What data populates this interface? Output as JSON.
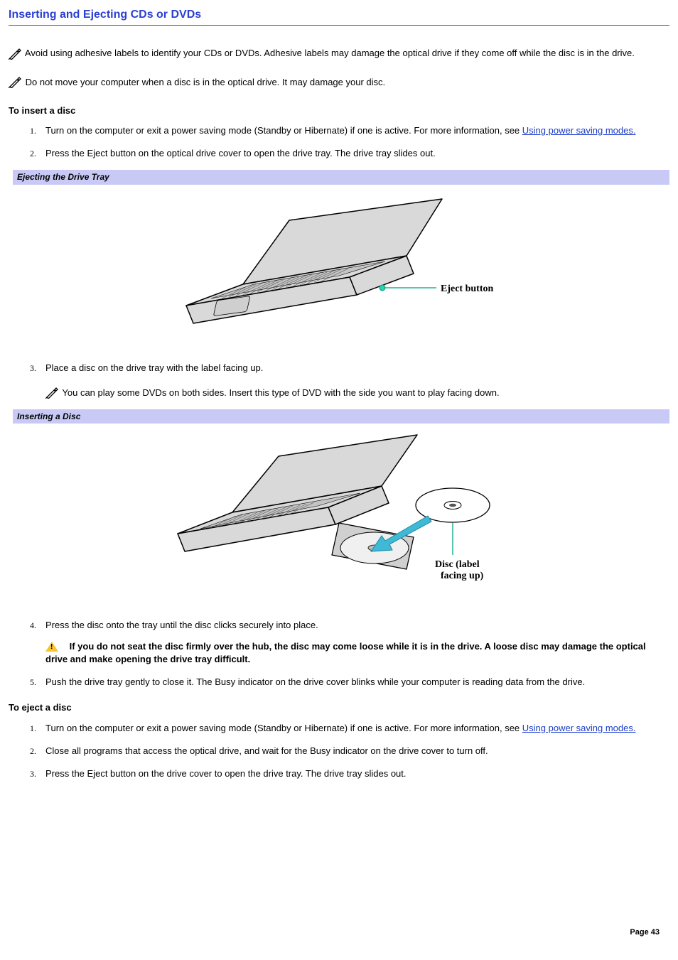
{
  "title": "Inserting and Ejecting CDs or DVDs",
  "notes": {
    "adhesive": "Avoid using adhesive labels to identify your CDs or DVDs. Adhesive labels may damage the optical drive if they come off while the disc is in the drive.",
    "moving": "Do not move your computer when a disc is in the optical drive. It may damage your disc.",
    "dvd_sides": "You can play some DVDs on both sides. Insert this type of DVD with the side you want to play facing down."
  },
  "insert": {
    "heading": "To insert a disc",
    "steps": {
      "s1_a": "Turn on the computer or exit a power saving mode (Standby or Hibernate) if one is active. For more information, see ",
      "s1_link": "Using power saving modes.",
      "s2": "Press the Eject button on the optical drive cover to open the drive tray. The drive tray slides out.",
      "s3": "Place a disc on the drive tray with the label facing up.",
      "s4": "Press the disc onto the tray until the disc clicks securely into place.",
      "s5": "Push the drive tray gently to close it. The Busy indicator on the drive cover blinks while your computer is reading data from the drive."
    }
  },
  "eject": {
    "heading": "To eject a disc",
    "steps": {
      "s1_a": "Turn on the computer or exit a power saving mode (Standby or Hibernate) if one is active. For more information, see ",
      "s1_link": "Using power saving modes.",
      "s2": "Close all programs that access the optical drive, and wait for the Busy indicator on the drive cover to turn off.",
      "s3": "Press the Eject button on the drive cover to open the drive tray. The drive tray slides out."
    }
  },
  "captions": {
    "eject_tray": "Ejecting the Drive Tray",
    "insert_disc": "Inserting a Disc"
  },
  "figure_labels": {
    "eject_button": "Eject button",
    "disc_label_a": "Disc (label",
    "disc_label_b": "facing up)"
  },
  "warning": "If you do not seat the disc firmly over the hub, the disc may come loose while it is in the drive. A loose disc may damage the optical drive and make opening the drive tray difficult.",
  "page_number": "Page 43"
}
